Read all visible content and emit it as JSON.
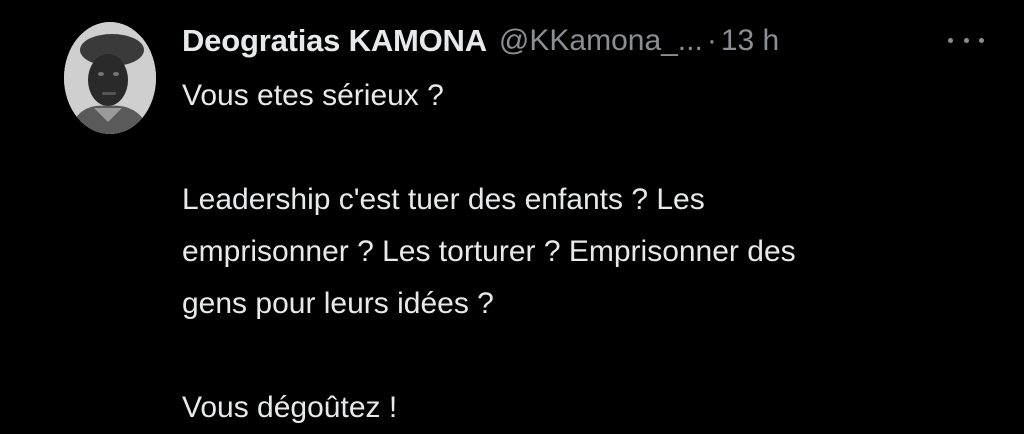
{
  "tweet": {
    "author": {
      "display_name": "Deogratias KAMONA",
      "handle": "@KKamona_...",
      "avatar": "avatar-photo"
    },
    "separator": "·",
    "time": "13 h",
    "more_icon": "more-horizontal-icon",
    "paragraphs": [
      "Vous etes sérieux ?",
      "Leadership c'est tuer des enfants ? Les",
      "emprisonner ? Les torturer ? Emprisonner des",
      "gens pour leurs idées ?",
      "Vous dégoûtez !"
    ]
  },
  "colors": {
    "background": "#000000",
    "primary_text": "#e7e9ea",
    "secondary_text": "#8b8f94"
  }
}
